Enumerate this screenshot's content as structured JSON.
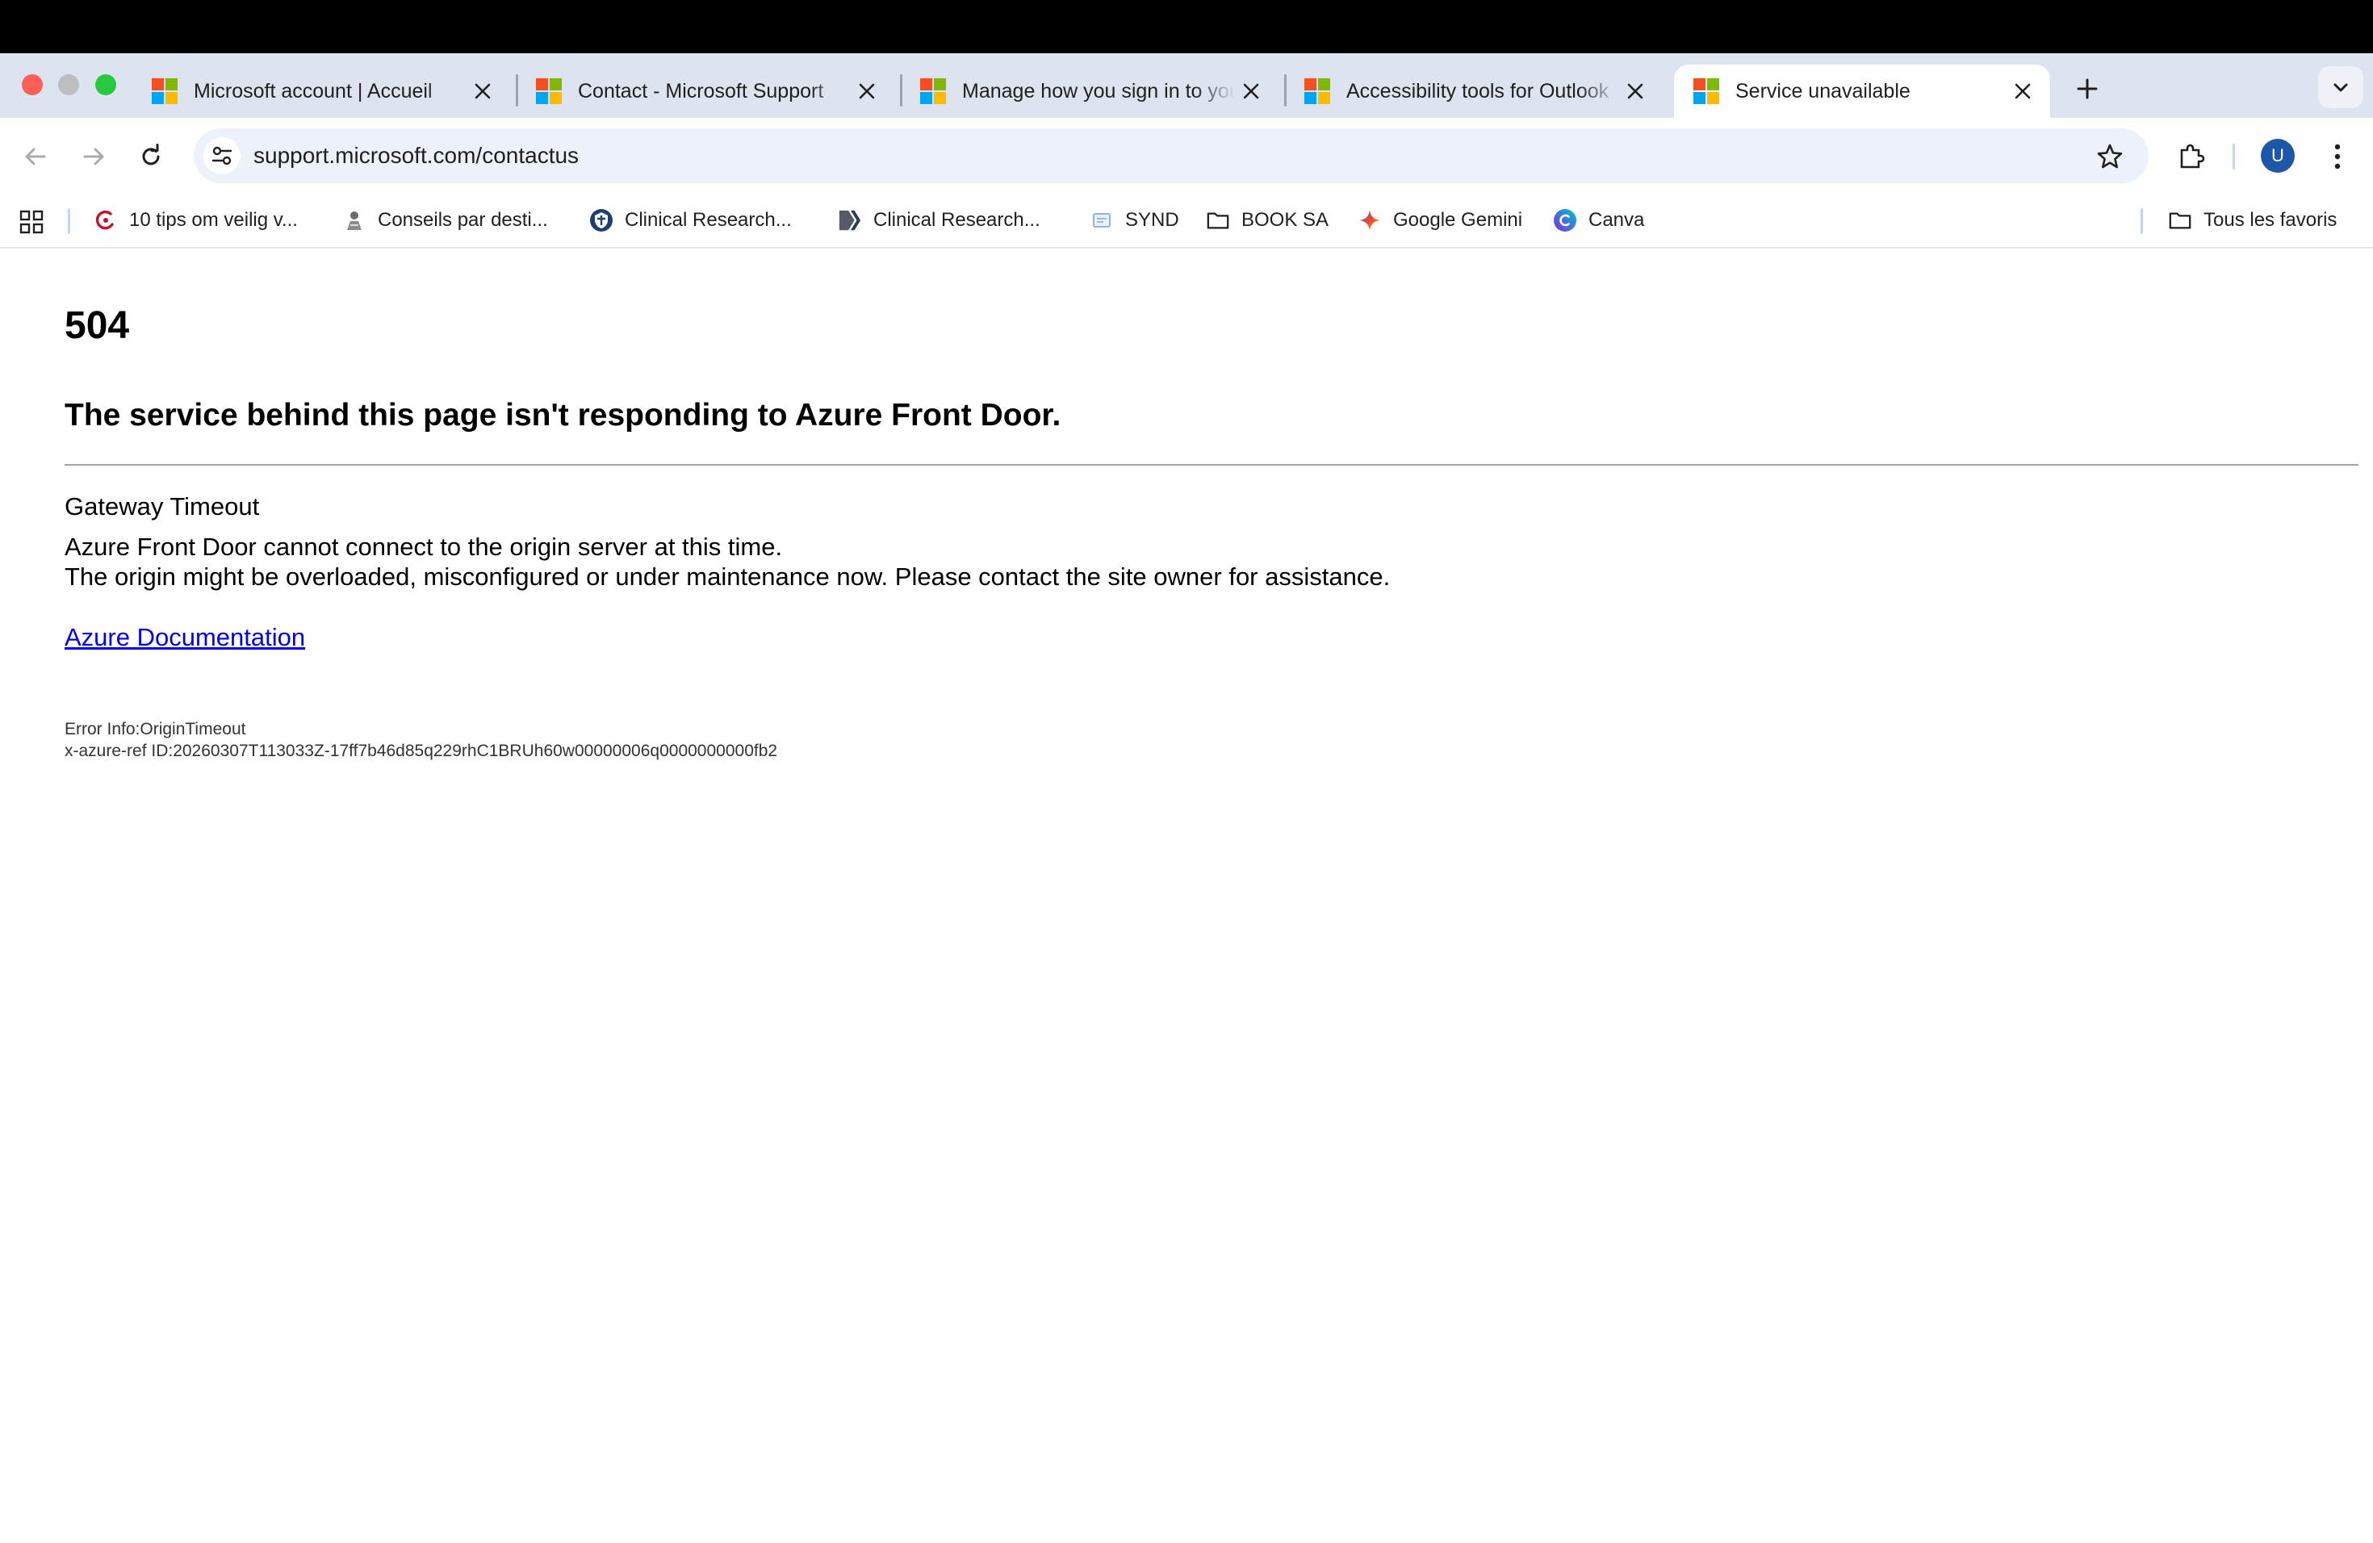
{
  "colors": {
    "tabstrip_bg": "#dde3ef",
    "link": "#0000ee",
    "avatar": "#1d57a8",
    "close_dot": "#ff5f57",
    "minimize_dot": "#bdbdc2",
    "zoom_dot": "#28c840"
  },
  "tabs": [
    {
      "title": "Microsoft account | Accueil",
      "icon": "microsoft-logo-icon",
      "active": false
    },
    {
      "title": "Contact - Microsoft Support",
      "icon": "microsoft-logo-icon",
      "active": false
    },
    {
      "title": "Manage how you sign in to your Microsoft account",
      "icon": "microsoft-logo-icon",
      "active": false
    },
    {
      "title": "Accessibility tools for Outlook",
      "icon": "microsoft-logo-icon",
      "active": false
    },
    {
      "title": "Service unavailable",
      "icon": "microsoft-logo-icon",
      "active": true
    }
  ],
  "address_bar": {
    "url": "support.microsoft.com/contactus"
  },
  "profile": {
    "initial": "U"
  },
  "bookmarks": {
    "items": [
      {
        "label": "10 tips om veilig v...",
        "icon": "shield-swirl-icon"
      },
      {
        "label": "Conseils par desti...",
        "icon": "globe-person-icon"
      },
      {
        "label": "Clinical Research...",
        "icon": "clinical-research-shield-icon"
      },
      {
        "label": "Clinical Research...",
        "icon": "chevron-logo-icon"
      },
      {
        "label": "SYND",
        "icon": "document-icon"
      },
      {
        "label": "BOOK SA",
        "icon": "folder-icon"
      },
      {
        "label": "Google Gemini",
        "icon": "gemini-sparkle-icon"
      },
      {
        "label": "Canva",
        "icon": "canva-logo-icon"
      }
    ],
    "all_bookmarks": {
      "label": "Tous les favoris",
      "icon": "folder-icon"
    }
  },
  "page": {
    "status_code": "504",
    "heading": "The service behind this page isn't responding to Azure Front Door.",
    "subheading": "Gateway Timeout",
    "message_line1": "Azure Front Door cannot connect to the origin server at this time.",
    "message_line2": "The origin might be overloaded, misconfigured or under maintenance now. Please contact the site owner for assistance.",
    "doc_link": "Azure Documentation",
    "error_info": "Error Info:OriginTimeout",
    "azure_ref": "x-azure-ref ID:20260307T113033Z-17ff7b46d85q229rhC1BRUh60w00000006q0000000000fb2"
  }
}
